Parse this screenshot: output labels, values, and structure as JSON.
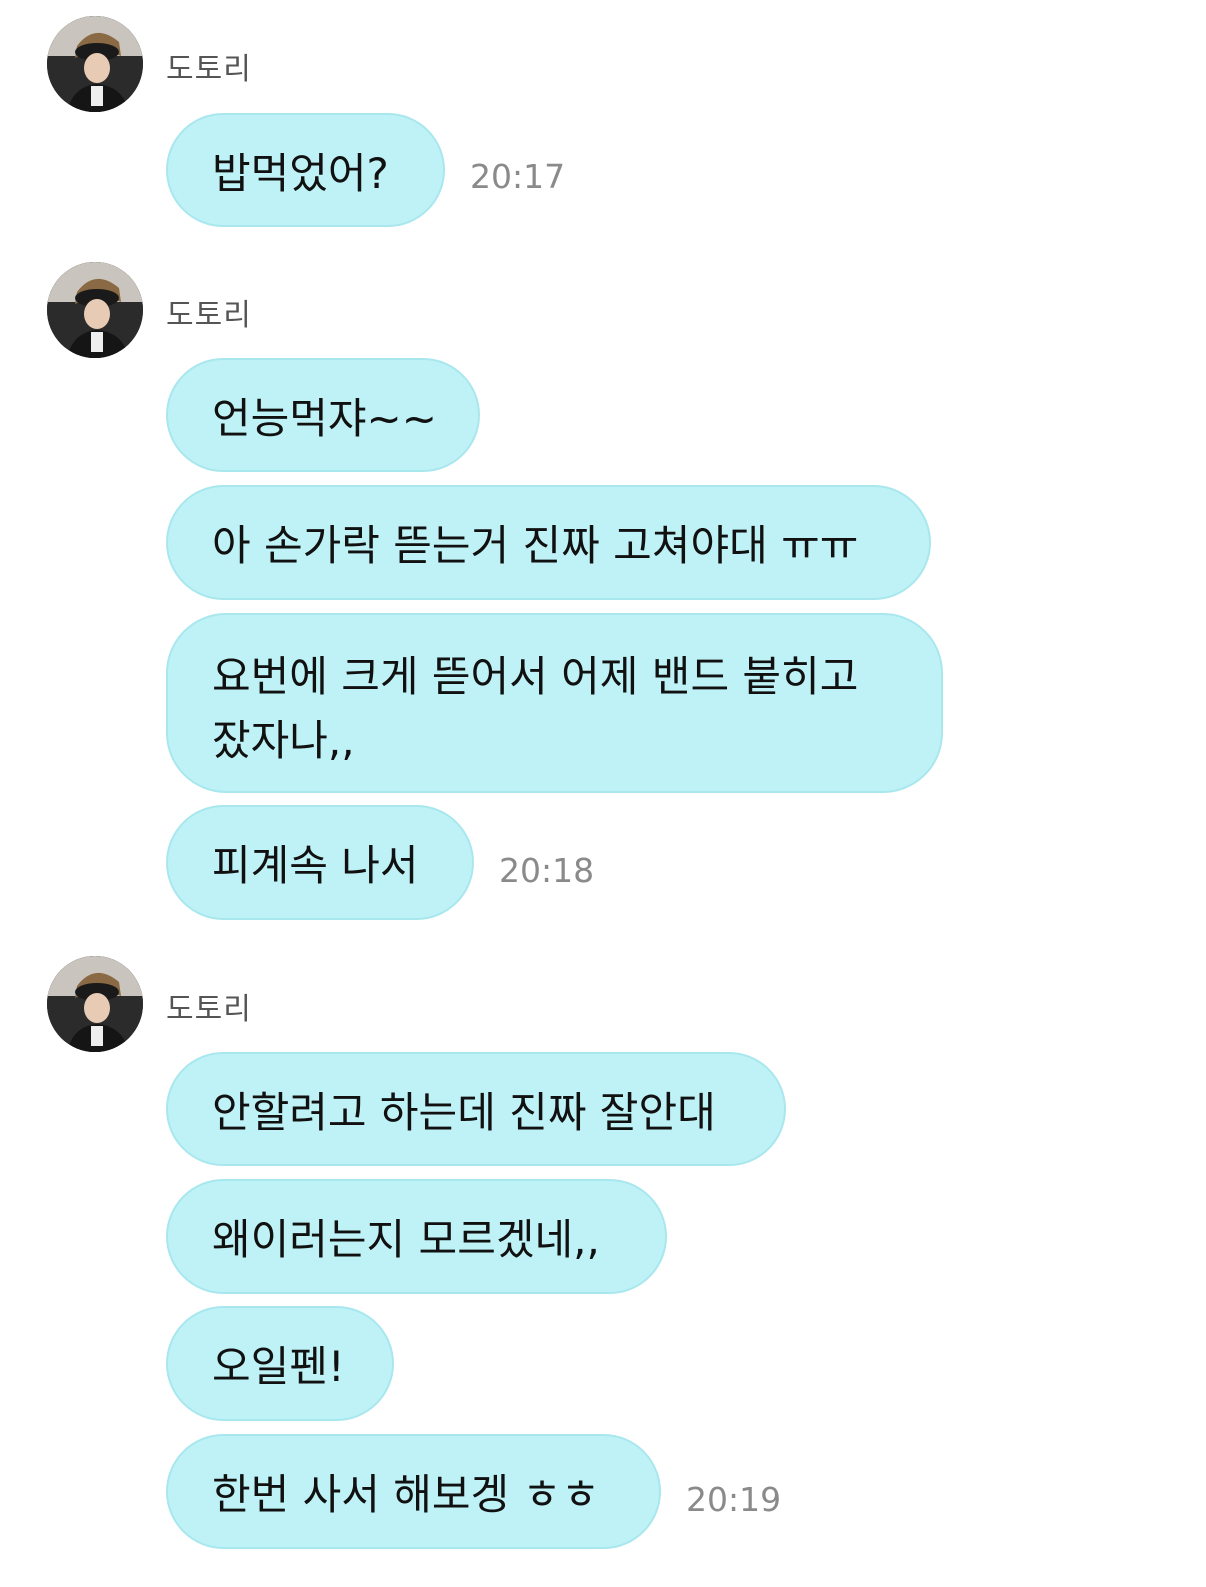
{
  "chat": {
    "groups": [
      {
        "sender": "도토리",
        "messages": [
          {
            "text": "밥먹었어?",
            "time": "20:17"
          }
        ]
      },
      {
        "sender": "도토리",
        "messages": [
          {
            "text": "언능먹쟈~~"
          },
          {
            "text": "아 손가락 뜯는거 진짜 고쳐야대 ㅠㅠ"
          },
          {
            "text": "요번에 크게 뜯어서 어제 밴드 붙히고 잤자나,,"
          },
          {
            "text": "피계속 나서",
            "time": "20:18"
          }
        ]
      },
      {
        "sender": "도토리",
        "messages": [
          {
            "text": "안할려고 하는데 진짜 잘안대"
          },
          {
            "text": "왜이러는지 모르겠네,,"
          },
          {
            "text": "오일펜!"
          },
          {
            "text": "한번 사서 해보겡 ㅎㅎ",
            "time": "20:19"
          }
        ]
      }
    ]
  },
  "colors": {
    "bubble": "#bff2f6",
    "bubble_border": "#a9e7ee",
    "time": "#8a8a8a",
    "sender": "#555555"
  },
  "icons": {
    "avatar": "profile-photo"
  }
}
